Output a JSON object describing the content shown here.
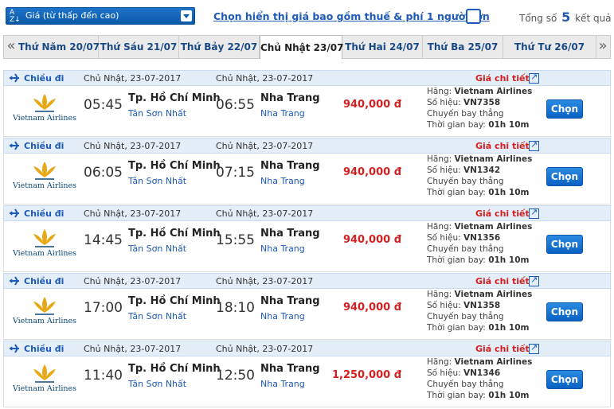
{
  "sort": {
    "label": "Giá (từ thấp đến cao)",
    "icon": "sort-az-icon"
  },
  "tax_toggle": {
    "label": "Chọn hiển thị giá bao gồm thuế & phí 1 người lớn",
    "checked": false
  },
  "results": {
    "prefix": "Tổng số",
    "count": "5",
    "suffix": "kết quả"
  },
  "date_tabs": [
    {
      "label": "Thứ Năm 20/07",
      "active": false
    },
    {
      "label": "Thứ Sáu 21/07",
      "active": false
    },
    {
      "label": "Thứ Bảy 22/07",
      "active": false
    },
    {
      "label": "Chủ Nhật 23/07",
      "active": true
    },
    {
      "label": "Thứ Hai 24/07",
      "active": false
    },
    {
      "label": "Thứ Ba 25/07",
      "active": false
    },
    {
      "label": "Thứ Tư 26/07",
      "active": false
    }
  ],
  "nav": {
    "prev": "«",
    "next": "»"
  },
  "flights": [
    {
      "direction": "Chiều đi",
      "dep_date": "Chủ Nhật, 23-07-2017",
      "arr_date": "Chủ Nhật, 23-07-2017",
      "detail": "Giá chi tiết",
      "airline_brand": "Vietnam Airlines",
      "dep_time": "05:45",
      "dep_city": "Tp. Hồ Chí Minh",
      "dep_airport": "Tân Sơn Nhất",
      "arr_time": "06:55",
      "arr_city": "Nha Trang",
      "arr_airport": "Nha Trang",
      "price": "940,000 đ",
      "airline_label": "Hãng:",
      "airline": "Vietnam Airlines",
      "flight_label": "Số hiệu:",
      "flight_no": "VN7358",
      "stops": "Chuyến bay thẳng",
      "duration_label": "Thời gian bay:",
      "duration": "01h 10m",
      "button": "Chọn"
    },
    {
      "direction": "Chiều đi",
      "dep_date": "Chủ Nhật, 23-07-2017",
      "arr_date": "Chủ Nhật, 23-07-2017",
      "detail": "Giá chi tiết",
      "airline_brand": "Vietnam Airlines",
      "dep_time": "06:05",
      "dep_city": "Tp. Hồ Chí Minh",
      "dep_airport": "Tân Sơn Nhất",
      "arr_time": "07:15",
      "arr_city": "Nha Trang",
      "arr_airport": "Nha Trang",
      "price": "940,000 đ",
      "airline_label": "Hãng:",
      "airline": "Vietnam Airlines",
      "flight_label": "Số hiệu:",
      "flight_no": "VN1342",
      "stops": "Chuyến bay thẳng",
      "duration_label": "Thời gian bay:",
      "duration": "01h 10m",
      "button": "Chọn"
    },
    {
      "direction": "Chiều đi",
      "dep_date": "Chủ Nhật, 23-07-2017",
      "arr_date": "Chủ Nhật, 23-07-2017",
      "detail": "Giá chi tiết",
      "airline_brand": "Vietnam Airlines",
      "dep_time": "14:45",
      "dep_city": "Tp. Hồ Chí Minh",
      "dep_airport": "Tân Sơn Nhất",
      "arr_time": "15:55",
      "arr_city": "Nha Trang",
      "arr_airport": "Nha Trang",
      "price": "940,000 đ",
      "airline_label": "Hãng:",
      "airline": "Vietnam Airlines",
      "flight_label": "Số hiệu:",
      "flight_no": "VN1356",
      "stops": "Chuyến bay thẳng",
      "duration_label": "Thời gian bay:",
      "duration": "01h 10m",
      "button": "Chọn"
    },
    {
      "direction": "Chiều đi",
      "dep_date": "Chủ Nhật, 23-07-2017",
      "arr_date": "Chủ Nhật, 23-07-2017",
      "detail": "Giá chi tiết",
      "airline_brand": "Vietnam Airlines",
      "dep_time": "17:00",
      "dep_city": "Tp. Hồ Chí Minh",
      "dep_airport": "Tân Sơn Nhất",
      "arr_time": "18:10",
      "arr_city": "Nha Trang",
      "arr_airport": "Nha Trang",
      "price": "940,000 đ",
      "airline_label": "Hãng:",
      "airline": "Vietnam Airlines",
      "flight_label": "Số hiệu:",
      "flight_no": "VN1358",
      "stops": "Chuyến bay thẳng",
      "duration_label": "Thời gian bay:",
      "duration": "01h 10m",
      "button": "Chọn"
    },
    {
      "direction": "Chiều đi",
      "dep_date": "Chủ Nhật, 23-07-2017",
      "arr_date": "Chủ Nhật, 23-07-2017",
      "detail": "Giá chi tiết",
      "airline_brand": "Vietnam Airlines",
      "dep_time": "11:40",
      "dep_city": "Tp. Hồ Chí Minh",
      "dep_airport": "Tân Sơn Nhất",
      "arr_time": "12:50",
      "arr_city": "Nha Trang",
      "arr_airport": "Nha Trang",
      "price": "1,250,000 đ",
      "airline_label": "Hãng:",
      "airline": "Vietnam Airlines",
      "flight_label": "Số hiệu:",
      "flight_no": "VN1346",
      "stops": "Chuyến bay thẳng",
      "duration_label": "Thời gian bay:",
      "duration": "01h 10m",
      "button": "Chọn"
    }
  ],
  "colors": {
    "accent": "#1e5ab8",
    "price": "#d42020",
    "button": "#0b62c4",
    "header_bg": "#e3eef8"
  }
}
